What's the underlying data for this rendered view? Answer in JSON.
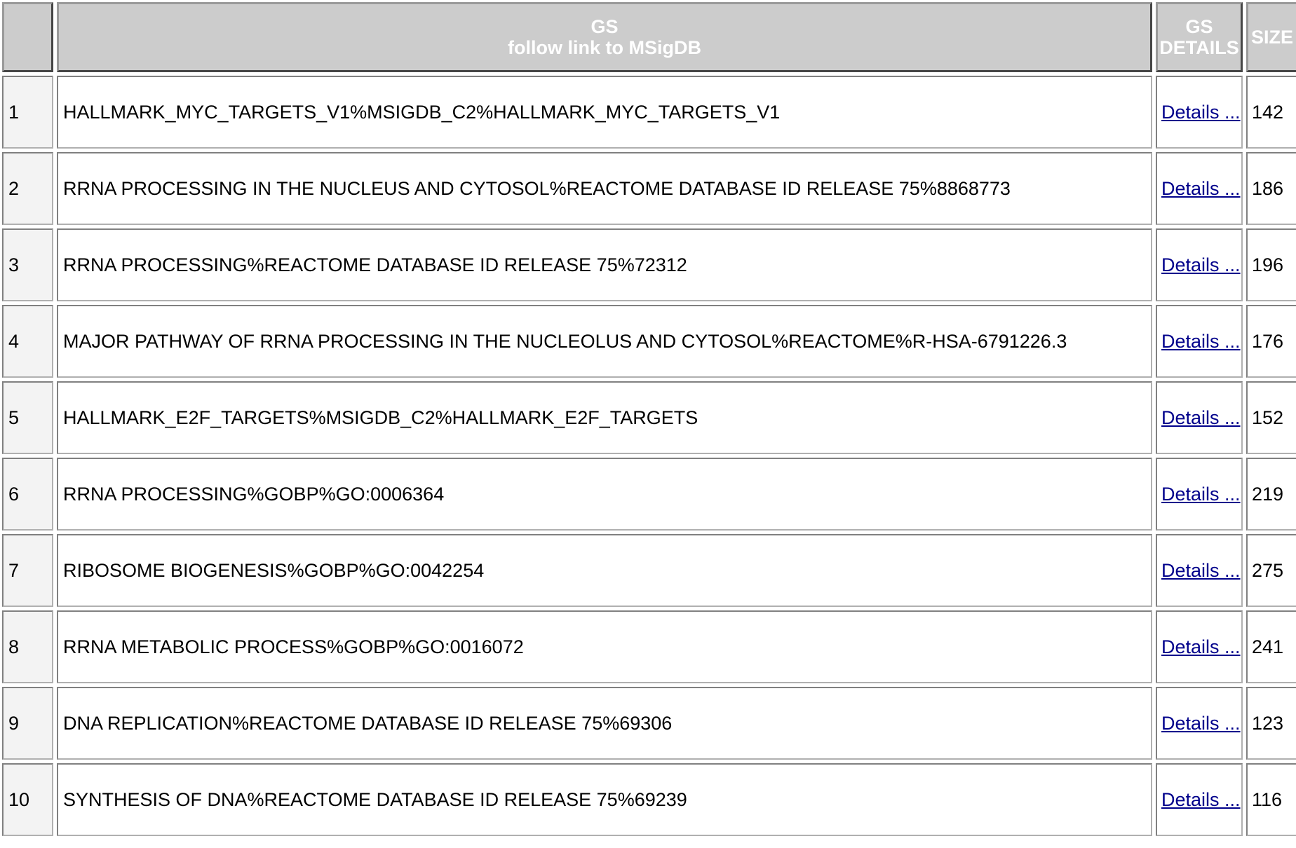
{
  "header": {
    "rank": "",
    "gs_line1": "GS",
    "gs_line2": "follow link to MSigDB",
    "details_line1": "GS",
    "details_line2": "DETAILS",
    "size": "SIZE"
  },
  "rows": [
    {
      "rank": "1",
      "name": "HALLMARK_MYC_TARGETS_V1%MSIGDB_C2%HALLMARK_MYC_TARGETS_V1",
      "details": "Details ...",
      "size": "142"
    },
    {
      "rank": "2",
      "name": "RRNA PROCESSING IN THE NUCLEUS AND CYTOSOL%REACTOME DATABASE ID RELEASE 75%8868773",
      "details": "Details ...",
      "size": "186"
    },
    {
      "rank": "3",
      "name": "RRNA PROCESSING%REACTOME DATABASE ID RELEASE 75%72312",
      "details": "Details ...",
      "size": "196"
    },
    {
      "rank": "4",
      "name": "MAJOR PATHWAY OF RRNA PROCESSING IN THE NUCLEOLUS AND CYTOSOL%REACTOME%R-HSA-6791226.3",
      "details": "Details ...",
      "size": "176"
    },
    {
      "rank": "5",
      "name": "HALLMARK_E2F_TARGETS%MSIGDB_C2%HALLMARK_E2F_TARGETS",
      "details": "Details ...",
      "size": "152"
    },
    {
      "rank": "6",
      "name": "RRNA PROCESSING%GOBP%GO:0006364",
      "details": "Details ...",
      "size": "219"
    },
    {
      "rank": "7",
      "name": "RIBOSOME BIOGENESIS%GOBP%GO:0042254",
      "details": "Details ...",
      "size": "275"
    },
    {
      "rank": "8",
      "name": "RRNA METABOLIC PROCESS%GOBP%GO:0016072",
      "details": "Details ...",
      "size": "241"
    },
    {
      "rank": "9",
      "name": "DNA REPLICATION%REACTOME DATABASE ID RELEASE 75%69306",
      "details": "Details ...",
      "size": "123"
    },
    {
      "rank": "10",
      "name": "SYNTHESIS OF DNA%REACTOME DATABASE ID RELEASE 75%69239",
      "details": "Details ...",
      "size": "116"
    }
  ]
}
